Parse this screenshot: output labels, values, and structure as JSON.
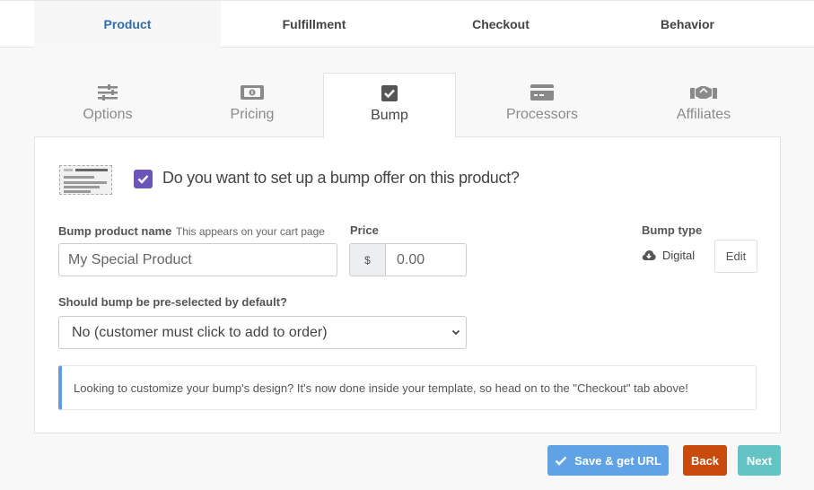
{
  "top_tabs": [
    {
      "label": "Product",
      "active": true
    },
    {
      "label": "Fulfillment",
      "active": false
    },
    {
      "label": "Checkout",
      "active": false
    },
    {
      "label": "Behavior",
      "active": false
    }
  ],
  "sub_tabs": [
    {
      "label": "Options",
      "icon": "sliders-icon",
      "active": false
    },
    {
      "label": "Pricing",
      "icon": "money-bill-icon",
      "active": false
    },
    {
      "label": "Bump",
      "icon": "check-square-icon",
      "active": true
    },
    {
      "label": "Processors",
      "icon": "credit-card-icon",
      "active": false
    },
    {
      "label": "Affiliates",
      "icon": "handshake-icon",
      "active": false
    }
  ],
  "bump": {
    "enabled": true,
    "question": "Do you want to set up a bump offer on this product?",
    "name_label": "Bump product name",
    "name_hint": "This appears on your cart page",
    "name_value": "My Special Product",
    "price_label": "Price",
    "currency_symbol": "$",
    "price_value": "0.00",
    "type_label": "Bump type",
    "type_value": "Digital",
    "edit_label": "Edit",
    "preselect_label": "Should bump be pre-selected by default?",
    "preselect_value": "No (customer must click to add to order)",
    "notice": "Looking to customize your bump's design? It's now done inside your template, so head on to the \"Checkout\" tab above!"
  },
  "footer": {
    "save_label": "Save & get URL",
    "back_label": "Back",
    "next_label": "Next"
  },
  "colors": {
    "accent_blue": "#336da8",
    "checkbox_purple": "#6a55b8",
    "save_blue": "#5fa2e6",
    "back_orange": "#c84b0c",
    "next_teal": "#64c4c4",
    "notice_border": "#5d9cec"
  }
}
